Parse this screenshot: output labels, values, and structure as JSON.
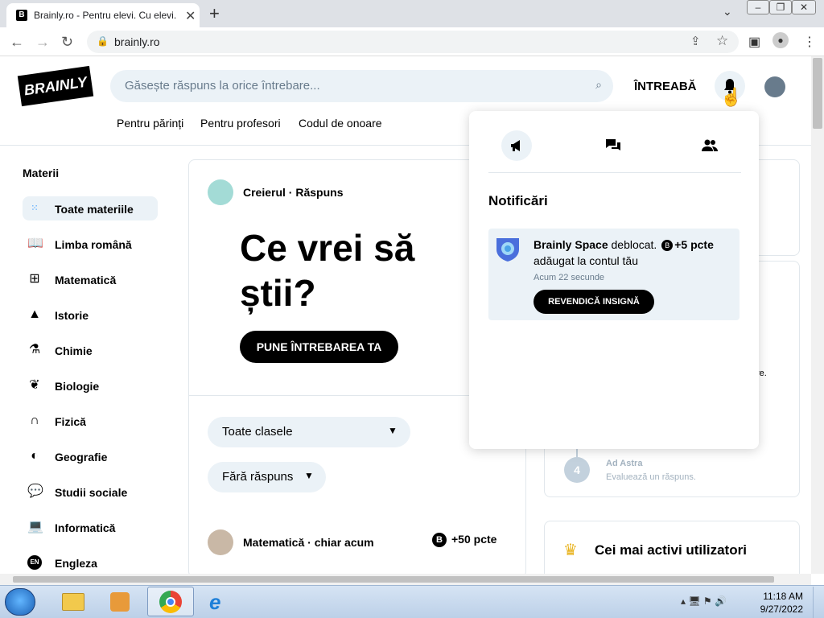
{
  "browser": {
    "tab_title": "Brainly.ro - Pentru elevi. Cu elevi.",
    "url": "brainly.ro"
  },
  "header": {
    "logo_text": "BRAINLY",
    "search_placeholder": "Găsește răspuns la orice întrebare...",
    "ask_label": "ÎNTREABĂ",
    "links": [
      "Pentru părinți",
      "Pentru profesori",
      "Codul de onoare"
    ]
  },
  "sidebar": {
    "title": "Materii",
    "items": [
      {
        "label": "Toate materiile",
        "icon": "grid-dots-icon"
      },
      {
        "label": "Limba română",
        "icon": "book-icon"
      },
      {
        "label": "Matematică",
        "icon": "calculator-icon"
      },
      {
        "label": "Istorie",
        "icon": "pyramid-icon"
      },
      {
        "label": "Chimie",
        "icon": "flask-icon"
      },
      {
        "label": "Biologie",
        "icon": "leaf-icon"
      },
      {
        "label": "Fizică",
        "icon": "magnet-icon"
      },
      {
        "label": "Geografie",
        "icon": "globe-icon"
      },
      {
        "label": "Studii sociale",
        "icon": "chat-bubbles-icon"
      },
      {
        "label": "Informatică",
        "icon": "laptop-icon"
      },
      {
        "label": "Engleza",
        "icon": "language-en-icon"
      }
    ]
  },
  "main": {
    "bot_label": "Creierul · Răspuns",
    "hero_line1": "Ce vrei să",
    "hero_line2": "știi?",
    "ask_button": "PUNE ÎNTREBAREA TA",
    "filter_grade": "Toate clasele",
    "filter_status": "Fără răspuns",
    "question_meta": "Matematică · chiar acum",
    "question_points": "+50 pcte"
  },
  "right": {
    "clipped_text": "re.",
    "step_number": "4",
    "step_title": "Ad Astra",
    "step_sub": "Evaluează un răspuns.",
    "active_users_title": "Cei mai activi utilizatori"
  },
  "notifications": {
    "title": "Notificări",
    "item": {
      "name": "Brainly Space",
      "action": "deblocat.",
      "points": "+5 pcte",
      "rest": "adăugat la contul tău",
      "time": "Acum 22 secunde",
      "button": "REVENDICĂ INSIGNĂ"
    }
  },
  "taskbar": {
    "time": "11:18 AM",
    "date": "9/27/2022"
  }
}
